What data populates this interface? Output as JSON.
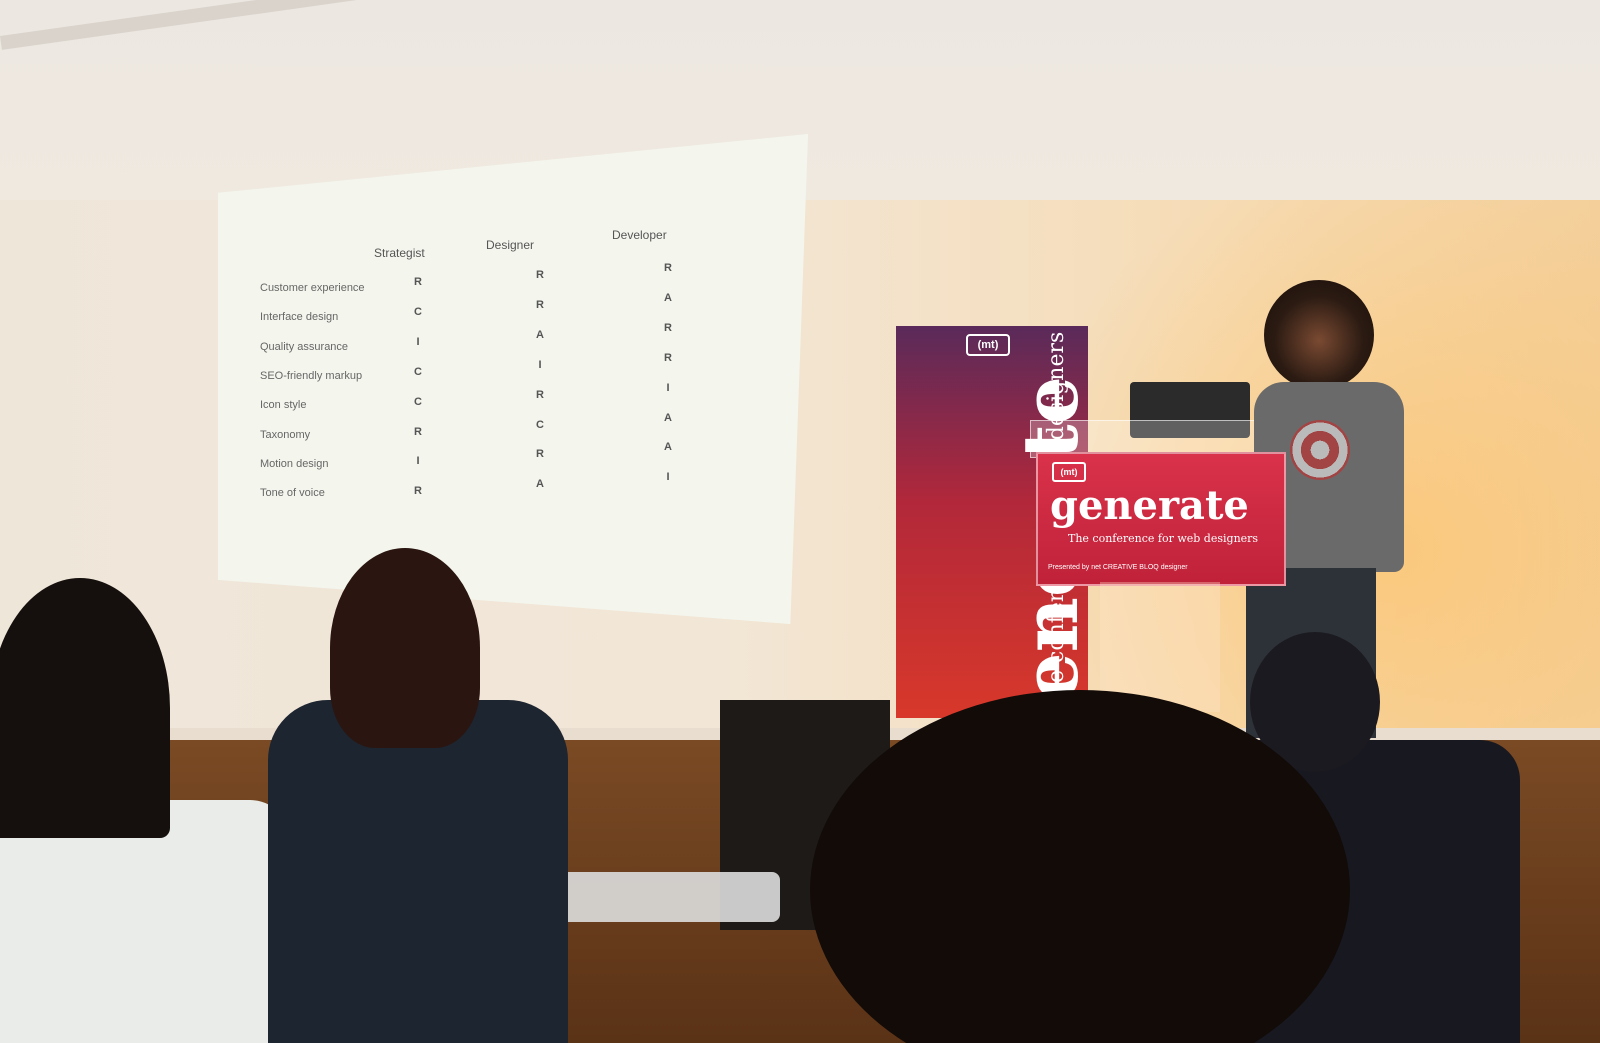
{
  "slide": {
    "columns": [
      "Strategist",
      "Designer",
      "Developer"
    ],
    "rows": [
      {
        "label": "Customer experience",
        "values": [
          "R",
          "R",
          "R"
        ]
      },
      {
        "label": "Interface design",
        "values": [
          "C",
          "R",
          "A"
        ]
      },
      {
        "label": "Quality assurance",
        "values": [
          "I",
          "A",
          "R"
        ]
      },
      {
        "label": "SEO-friendly markup",
        "values": [
          "C",
          "I",
          "R"
        ]
      },
      {
        "label": "Icon style",
        "values": [
          "C",
          "R",
          "I"
        ]
      },
      {
        "label": "Taxonomy",
        "values": [
          "R",
          "C",
          "A"
        ]
      },
      {
        "label": "Motion design",
        "values": [
          "I",
          "R",
          "A"
        ]
      },
      {
        "label": "Tone of voice",
        "values": [
          "R",
          "A",
          "I"
        ]
      }
    ]
  },
  "banner": {
    "logo": "(mt)",
    "word": "generate",
    "tagline": "the conference for web designers"
  },
  "podium": {
    "logo": "(mt)",
    "word": "generate",
    "tagline": "The conference for web designers",
    "footer": "Presented by net  CREATIVE BLOQ  designer"
  },
  "colors": {
    "brand_red": "#c0223a",
    "slide_bg": "#f4f6ee"
  }
}
